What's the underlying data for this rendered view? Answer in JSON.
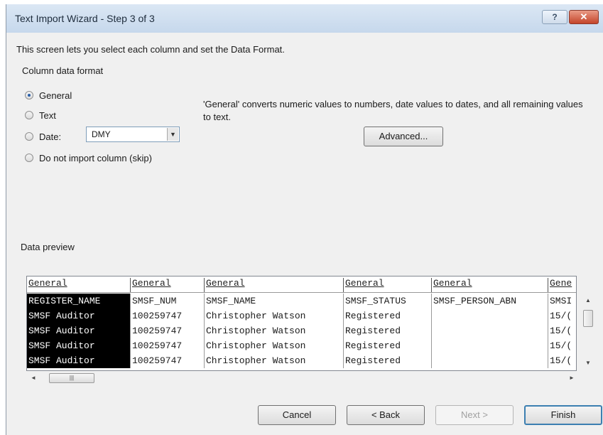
{
  "window": {
    "title": "Text Import Wizard - Step 3 of 3",
    "help_label": "?",
    "close_label": "✕"
  },
  "intro": "This screen lets you select each column and set the Data Format.",
  "column_format": {
    "group_label": "Column data format",
    "options": [
      {
        "label": "General",
        "checked": true
      },
      {
        "label": "Text",
        "checked": false
      },
      {
        "label": "Date:",
        "checked": false
      },
      {
        "label": "Do not import column (skip)",
        "checked": false
      }
    ],
    "date_value": "DMY"
  },
  "description": "'General' converts numeric values to numbers, date values to dates, and all remaining values to text.",
  "advanced_label": "Advanced...",
  "preview": {
    "label": "Data preview",
    "headers": [
      "General",
      "General",
      "General",
      "General",
      "General",
      "Gene"
    ],
    "rows": [
      [
        "REGISTER_NAME",
        "SMSF_NUM",
        "SMSF_NAME",
        "SMSF_STATUS",
        "SMSF_PERSON_ABN",
        "SMSI"
      ],
      [
        "SMSF Auditor",
        "100259747",
        "Christopher Watson",
        "Registered",
        "",
        "15/("
      ],
      [
        "SMSF Auditor",
        "100259747",
        "Christopher Watson",
        "Registered",
        "",
        "15/("
      ],
      [
        "SMSF Auditor",
        "100259747",
        "Christopher Watson",
        "Registered",
        "",
        "15/("
      ],
      [
        "SMSF Auditor",
        "100259747",
        "Christopher Watson",
        "Registered",
        "",
        "15/("
      ]
    ]
  },
  "buttons": {
    "cancel": "Cancel",
    "back": "< Back",
    "next": "Next >",
    "finish": "Finish"
  }
}
